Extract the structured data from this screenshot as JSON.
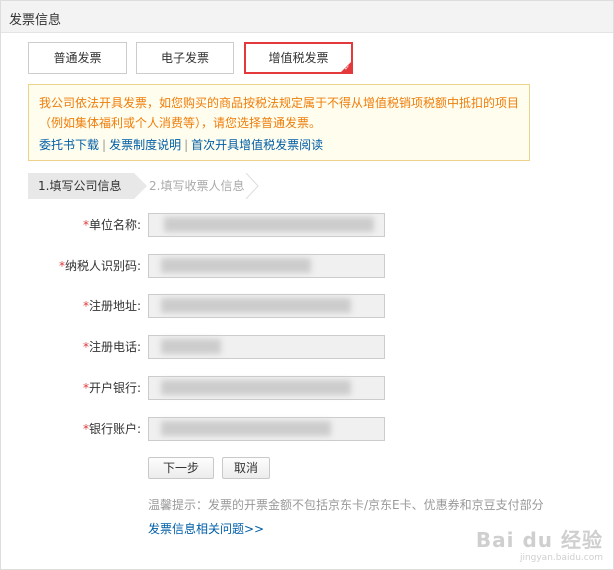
{
  "dialog": {
    "title": "发票信息"
  },
  "tabs": [
    {
      "label": "普通发票",
      "selected": false
    },
    {
      "label": "电子发票",
      "selected": false
    },
    {
      "label": "增值税发票",
      "selected": true
    }
  ],
  "notice": {
    "warning_line1": "我公司依法开具发票，如您购买的商品按税法规定属于不得从增值税销项税额中抵扣的项目",
    "warning_line2": "（例如集体福利或个人消费等），请您选择普通发票。",
    "links": [
      {
        "label": "委托书下载"
      },
      {
        "label": "发票制度说明"
      },
      {
        "label": "首次开具增值税发票阅读"
      }
    ],
    "link_separator": "|"
  },
  "steps": [
    {
      "label": "1.填写公司信息",
      "active": true
    },
    {
      "label": "2.填写收票人信息",
      "active": false
    }
  ],
  "form": {
    "required_mark": "*",
    "fields": [
      {
        "label": "单位名称:",
        "value": ""
      },
      {
        "label": "纳税人识别码:",
        "value": ""
      },
      {
        "label": "注册地址:",
        "value": ""
      },
      {
        "label": "注册电话:",
        "value": ""
      },
      {
        "label": "开户银行:",
        "value": ""
      },
      {
        "label": "银行账户:",
        "value": ""
      }
    ]
  },
  "buttons": {
    "next": "下一步",
    "cancel": "取消"
  },
  "tip": "温馨提示：发票的开票金额不包括京东卡/京东E卡、优惠券和京豆支付部分",
  "faq_link": "发票信息相关问题>>",
  "watermark": {
    "logo": "Bai du 经验",
    "sub": "jingyan.baidu.com"
  },
  "colors": {
    "accent": "#e4393c",
    "link": "#005ea7",
    "warning_text": "#ef7d0b",
    "notice_bg": "#fffdee"
  }
}
